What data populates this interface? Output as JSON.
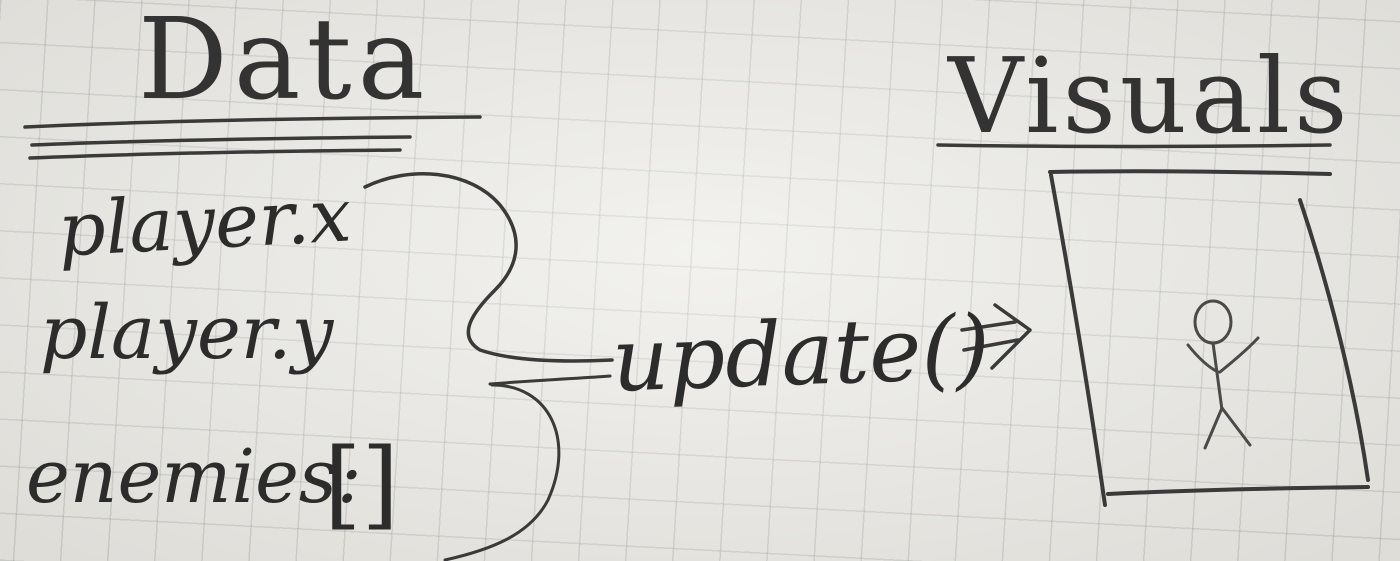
{
  "diagram": {
    "left_heading": "Data",
    "right_heading": "Visuals",
    "data_fields": [
      "player.x",
      "player.y",
      "enemies:"
    ],
    "enemies_value": "[]",
    "function_call": "update()"
  },
  "colors": {
    "paper": "#ecebe6",
    "grid": "#8a8a8a",
    "ink": "#2c2c2c",
    "pencil": "#4a4a4a"
  }
}
